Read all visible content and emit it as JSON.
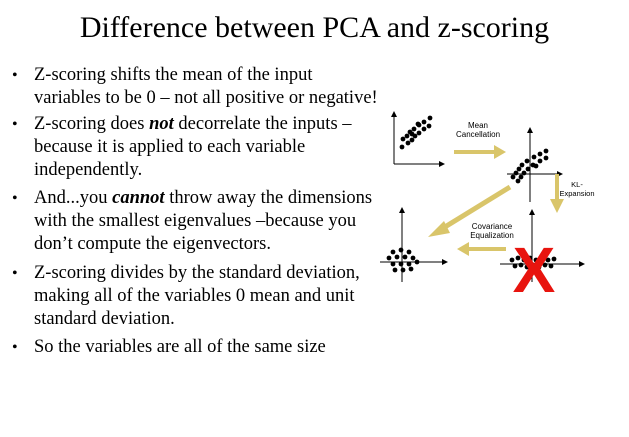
{
  "slide": {
    "title": "Difference between PCA and z-scoring",
    "bullets": [
      {
        "segments": [
          {
            "text": "Z-scoring shifts the mean of the input variables to be 0 – not all positive or negative!"
          }
        ]
      },
      {
        "segments": [
          {
            "text": "Z-scoring does "
          },
          {
            "text": "not",
            "style": "bold-italic"
          },
          {
            "text": " decorrelate the inputs – because it is applied to each variable independently."
          }
        ]
      },
      {
        "segments": [
          {
            "text": "And...you "
          },
          {
            "text": "cannot",
            "style": "bold-italic"
          },
          {
            "text": " throw away the dimensions with the smallest eigenvalues –because you don’t compute the eigenvectors."
          }
        ]
      },
      {
        "segments": [
          {
            "text": "Z-scoring divides by the standard deviation, making all of the variables 0 mean and unit standard deviation."
          }
        ]
      },
      {
        "segments": [
          {
            "text": "So the variables are all of the same size"
          }
        ]
      }
    ]
  },
  "diagram": {
    "label_mean": [
      "Mean",
      "Cancellation"
    ],
    "label_kl": [
      "KL-",
      "Expansion"
    ],
    "label_cov": [
      "Covariance",
      "Equalization"
    ],
    "cross_mark": "X",
    "colors": {
      "arrow": "#d9c56a",
      "cross": "#e8140e",
      "axis": "#000000"
    }
  }
}
